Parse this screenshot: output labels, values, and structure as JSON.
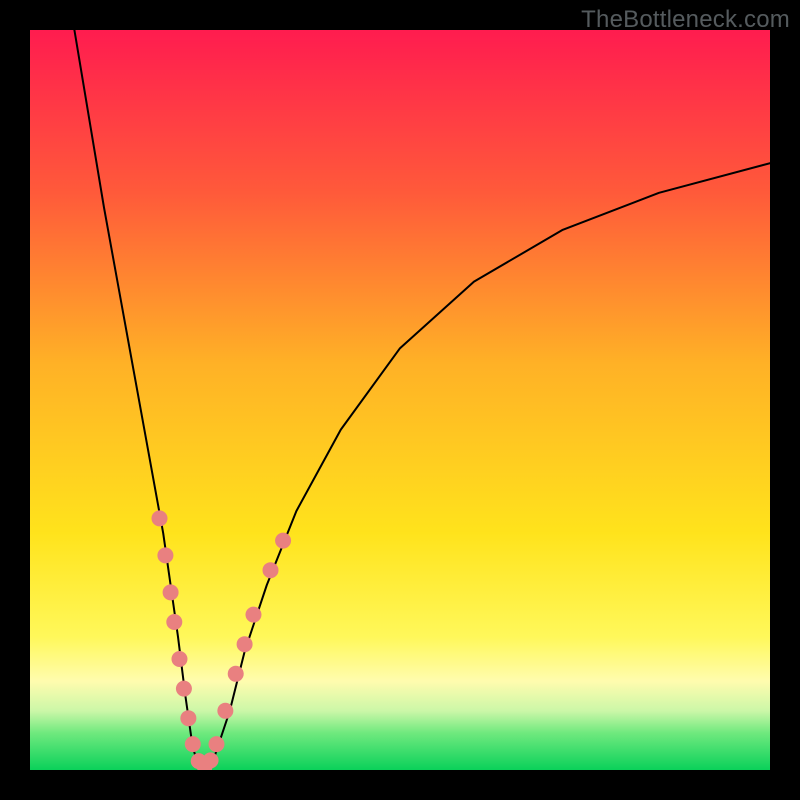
{
  "watermark": "TheBottleneck.com",
  "chart_data": {
    "type": "line",
    "title": "",
    "xlabel": "",
    "ylabel": "",
    "xlim": [
      0,
      100
    ],
    "ylim": [
      0,
      100
    ],
    "grid": false,
    "background_gradient": {
      "stops": [
        {
          "pos": 0.0,
          "color": "#ff1c4f"
        },
        {
          "pos": 0.22,
          "color": "#ff5a3a"
        },
        {
          "pos": 0.45,
          "color": "#ffb126"
        },
        {
          "pos": 0.68,
          "color": "#ffe31c"
        },
        {
          "pos": 0.82,
          "color": "#fff85a"
        },
        {
          "pos": 0.88,
          "color": "#fffcae"
        },
        {
          "pos": 0.92,
          "color": "#ccf7a8"
        },
        {
          "pos": 0.95,
          "color": "#6fe97e"
        },
        {
          "pos": 1.0,
          "color": "#0ad15a"
        }
      ]
    },
    "series": [
      {
        "name": "bottleneck-curve",
        "color": "#000000",
        "width": 2,
        "x": [
          6,
          8,
          10,
          12,
          14,
          16,
          18,
          19,
          20,
          21,
          22,
          23,
          24,
          25,
          27,
          29,
          32,
          36,
          42,
          50,
          60,
          72,
          85,
          100
        ],
        "y": [
          100,
          88,
          76,
          65,
          54,
          43,
          32,
          25,
          18,
          10,
          3,
          0,
          0,
          2,
          8,
          16,
          25,
          35,
          46,
          57,
          66,
          73,
          78,
          82
        ]
      }
    ],
    "markers": [
      {
        "name": "highlight-dots",
        "color": "#e98080",
        "radius": 8,
        "points": [
          {
            "x": 17.5,
            "y": 34
          },
          {
            "x": 18.3,
            "y": 29
          },
          {
            "x": 19.0,
            "y": 24
          },
          {
            "x": 19.5,
            "y": 20
          },
          {
            "x": 20.2,
            "y": 15
          },
          {
            "x": 20.8,
            "y": 11
          },
          {
            "x": 21.4,
            "y": 7
          },
          {
            "x": 22.0,
            "y": 3.5
          },
          {
            "x": 22.8,
            "y": 1.2
          },
          {
            "x": 23.6,
            "y": 0.5
          },
          {
            "x": 24.4,
            "y": 1.3
          },
          {
            "x": 25.2,
            "y": 3.5
          },
          {
            "x": 26.4,
            "y": 8
          },
          {
            "x": 27.8,
            "y": 13
          },
          {
            "x": 29.0,
            "y": 17
          },
          {
            "x": 30.2,
            "y": 21
          },
          {
            "x": 32.5,
            "y": 27
          },
          {
            "x": 34.2,
            "y": 31
          }
        ]
      }
    ]
  }
}
